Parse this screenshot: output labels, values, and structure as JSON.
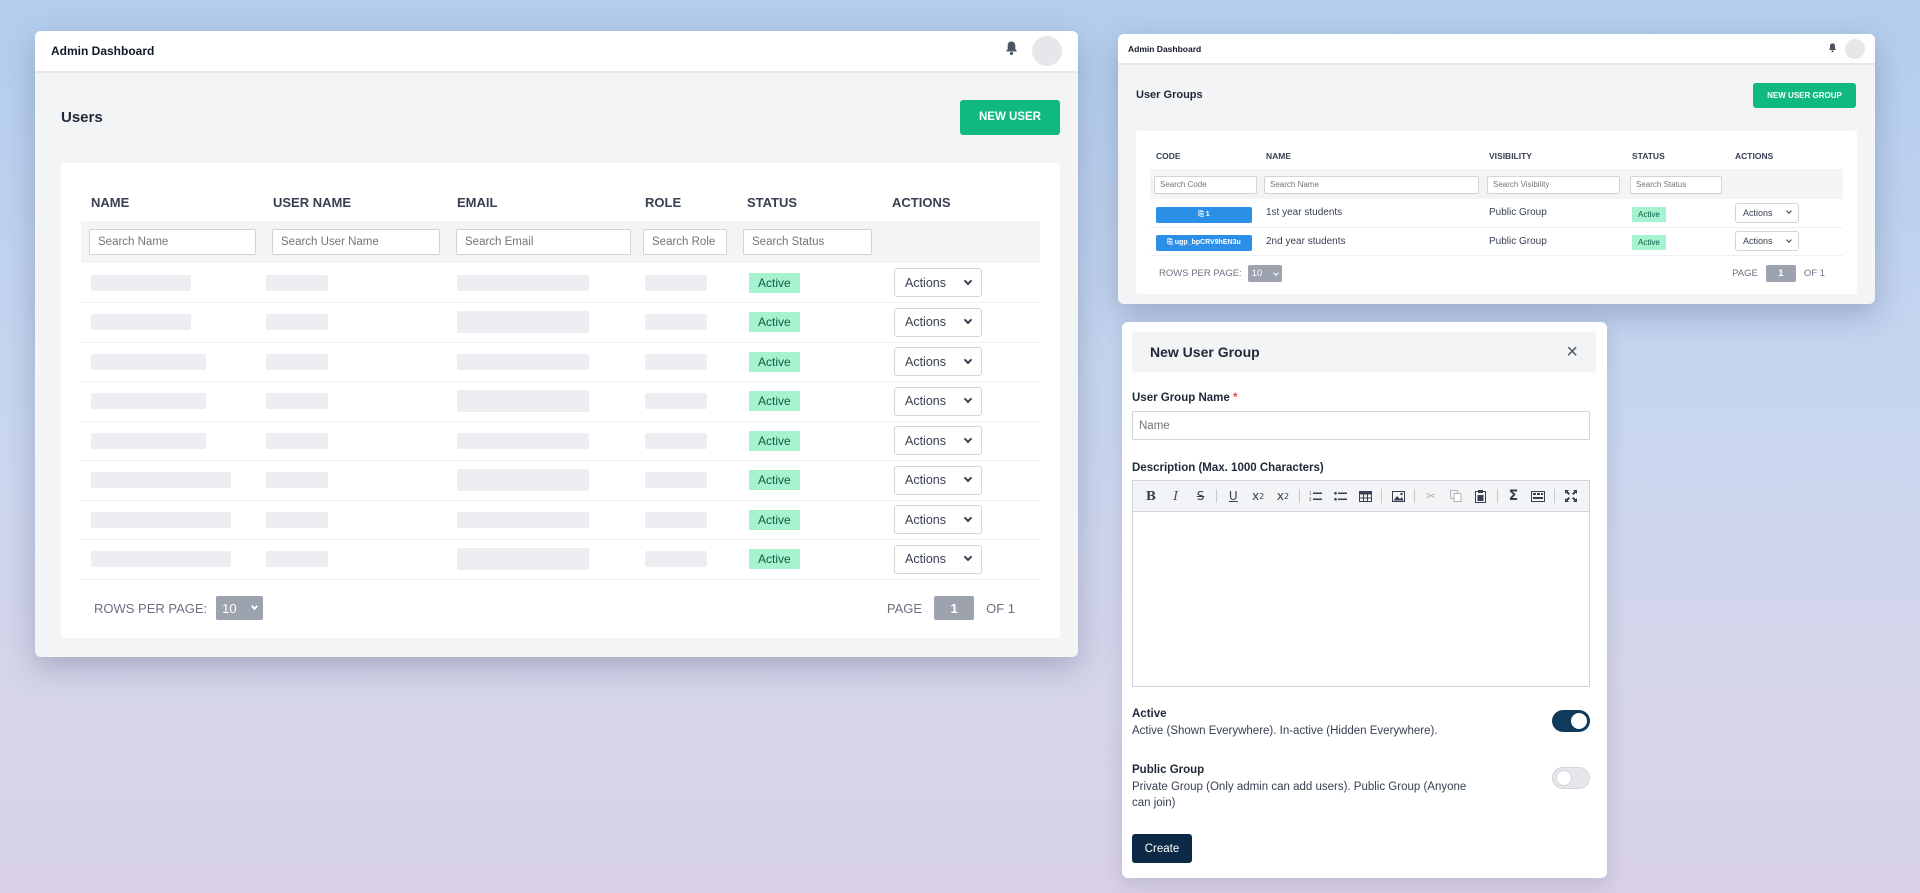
{
  "users_window": {
    "app_title": "Admin Dashboard",
    "page_title": "Users",
    "new_button": "NEW USER",
    "columns": [
      "NAME",
      "USER NAME",
      "EMAIL",
      "ROLE",
      "STATUS",
      "ACTIONS"
    ],
    "search_placeholders": [
      "Search Name",
      "Search User Name",
      "Search Email",
      "Search Role",
      "Search Status"
    ],
    "rows": [
      {
        "status": "Active",
        "action": "Actions"
      },
      {
        "status": "Active",
        "action": "Actions"
      },
      {
        "status": "Active",
        "action": "Actions"
      },
      {
        "status": "Active",
        "action": "Actions"
      },
      {
        "status": "Active",
        "action": "Actions"
      },
      {
        "status": "Active",
        "action": "Actions"
      },
      {
        "status": "Active",
        "action": "Actions"
      },
      {
        "status": "Active",
        "action": "Actions"
      }
    ],
    "rows_per_page_label": "ROWS PER PAGE:",
    "rows_per_page_value": "10",
    "page_label": "PAGE",
    "page_current": "1",
    "page_of": "OF 1"
  },
  "groups_window": {
    "app_title": "Admin Dashboard",
    "page_title": "User Groups",
    "new_button": "NEW USER GROUP",
    "columns": [
      "CODE",
      "NAME",
      "VISIBILITY",
      "STATUS",
      "ACTIONS"
    ],
    "search_placeholders": [
      "Search Code",
      "Search Name",
      "Search Visibility",
      "Search Status"
    ],
    "rows": [
      {
        "code": "⎘ 1",
        "name": "1st year students",
        "visibility": "Public Group",
        "status": "Active",
        "action": "Actions"
      },
      {
        "code": "⎘ ugp_bpCRV9hEN3u",
        "name": "2nd year students",
        "visibility": "Public Group",
        "status": "Active",
        "action": "Actions"
      }
    ],
    "rows_per_page_label": "ROWS PER PAGE:",
    "rows_per_page_value": "10",
    "page_label": "PAGE",
    "page_current": "1",
    "page_of": "OF 1"
  },
  "modal": {
    "title": "New User Group",
    "close_icon": "×",
    "name_label": "User Group Name",
    "required_mark": "*",
    "name_placeholder": "Name",
    "desc_label": "Description (Max. 1000 Characters)",
    "toolbar_icons": [
      "bold-icon",
      "italic-icon",
      "strikethrough-icon",
      "underline-icon",
      "subscript-icon",
      "superscript-icon",
      "ordered-list-icon",
      "unordered-list-icon",
      "table-icon",
      "image-icon",
      "cut-icon",
      "copy-icon",
      "paste-icon",
      "sum-icon",
      "special-char-icon",
      "fullscreen-icon"
    ],
    "active_title": "Active",
    "active_desc": "Active (Shown Everywhere). In-active (Hidden Everywhere).",
    "active_on": true,
    "public_title": "Public Group",
    "public_desc": "Private Group (Only admin can add users). Public Group (Anyone can join)",
    "public_on": false,
    "create_label": "Create"
  },
  "colors": {
    "accent_green": "#10b981",
    "badge_green": "#a7f3d0",
    "code_blue": "#2b8fe8",
    "navy": "#0c2a48"
  }
}
